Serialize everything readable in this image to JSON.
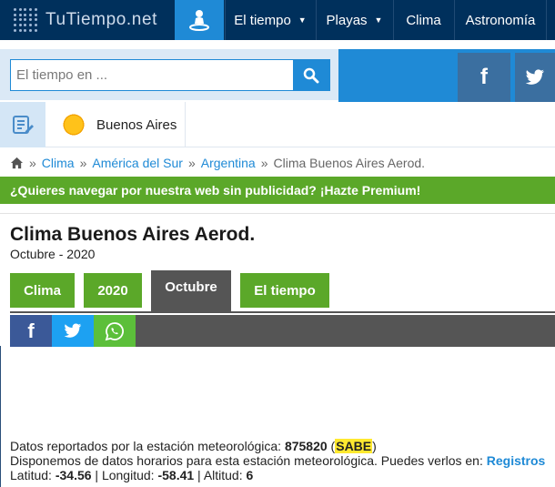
{
  "header": {
    "logo_text": "TuTiempo.net",
    "nav": [
      {
        "label": "El tiempo",
        "has_caret": true
      },
      {
        "label": "Playas",
        "has_caret": true
      },
      {
        "label": "Clima",
        "has_caret": false
      },
      {
        "label": "Astronomía",
        "has_caret": false
      }
    ]
  },
  "search": {
    "placeholder": "El tiempo en ..."
  },
  "location": {
    "city": "Buenos Aires"
  },
  "breadcrumb": {
    "items": [
      "Clima",
      "América del Sur",
      "Argentina"
    ],
    "current": "Clima Buenos Aires Aerod.",
    "separator": "»"
  },
  "premium": {
    "text": "¿Quieres navegar por nuestra web sin publicidad?",
    "cta": "¡Hazte Premium!"
  },
  "page": {
    "title": "Clima Buenos Aires Aerod.",
    "subtitle": "Octubre - 2020"
  },
  "tabs": [
    {
      "label": "Clima",
      "active": false
    },
    {
      "label": "2020",
      "active": false
    },
    {
      "label": "Octubre",
      "active": true
    },
    {
      "label": "El tiempo",
      "active": false
    }
  ],
  "station": {
    "reported_text": "Datos reportados por la estación meteorológica:",
    "id": "875820",
    "code": "SABE",
    "hourly_text": "Disponemos de datos horarios para esta estación meteorológica. Puedes verlos en:",
    "hourly_link": "Registros",
    "latitude_label": "Latitud:",
    "latitude": "-34.56",
    "longitude_label": "Longitud:",
    "longitude": "-58.41",
    "altitude_label": "Altitud:",
    "altitude": "6"
  },
  "colors": {
    "nav_bg": "#00305c",
    "accent_blue": "#1f8ad6",
    "green": "#5ba829",
    "dark_tab": "#555555",
    "highlight": "#ffe930"
  },
  "icons": [
    "user-location-icon",
    "search-icon",
    "facebook-icon",
    "twitter-icon",
    "edit-list-icon",
    "sun-icon",
    "home-icon",
    "whatsapp-icon"
  ]
}
